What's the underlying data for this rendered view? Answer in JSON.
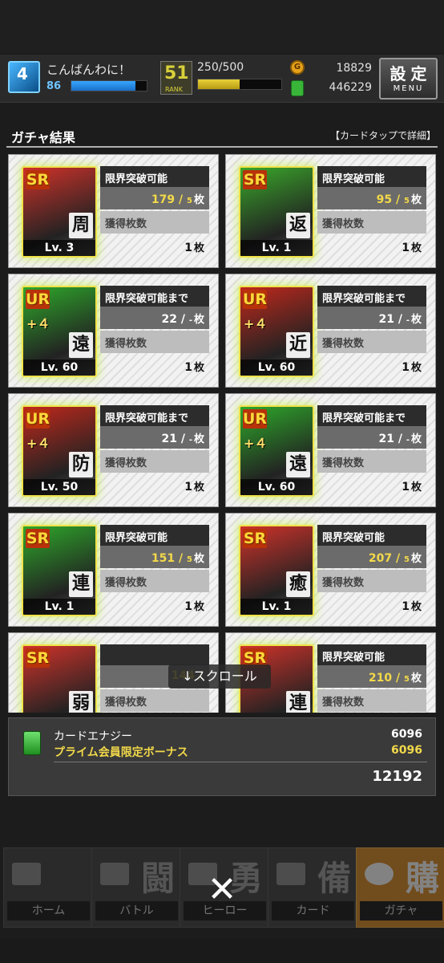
{
  "header": {
    "player_level": "4",
    "greeting": "こんばんわに！",
    "stamina": "86",
    "stamina_fill": 0.85,
    "rank": "51",
    "rank_label": "RANK",
    "exp": "250/500",
    "exp_fill": 0.5,
    "coins": "18829",
    "energy": "446229",
    "menu_label": "設定",
    "menu_sub": "MENU"
  },
  "results": {
    "title": "ガチャ結果",
    "hint": "【カードタップで詳細】",
    "cards": [
      {
        "rarity": "SR",
        "plus": "",
        "type": "周",
        "level": "Lv. 3",
        "status": "限界突破可能",
        "progress_num": "179",
        "progress_den": "5",
        "unit": "枚",
        "got_label": "獲得枚数",
        "got": "1",
        "color": "#d0322a",
        "gold": true
      },
      {
        "rarity": "SR",
        "plus": "",
        "type": "返",
        "level": "Lv. 1",
        "status": "限界突破可能",
        "progress_num": "95",
        "progress_den": "5",
        "unit": "枚",
        "got_label": "獲得枚数",
        "got": "1",
        "color": "#3aa82a",
        "gold": true
      },
      {
        "rarity": "UR",
        "plus": "+４",
        "type": "遠",
        "level": "Lv. 60",
        "status": "限界突破可能まで",
        "progress_num": "22",
        "progress_den": "-",
        "unit": "枚",
        "got_label": "獲得枚数",
        "got": "1",
        "color": "#2ea82a",
        "gold": false
      },
      {
        "rarity": "UR",
        "plus": "+４",
        "type": "近",
        "level": "Lv. 60",
        "status": "限界突破可能まで",
        "progress_num": "21",
        "progress_den": "-",
        "unit": "枚",
        "got_label": "獲得枚数",
        "got": "1",
        "color": "#c0281c",
        "gold": false
      },
      {
        "rarity": "UR",
        "plus": "+４",
        "type": "防",
        "level": "Lv. 50",
        "status": "限界突破可能まで",
        "progress_num": "21",
        "progress_den": "-",
        "unit": "枚",
        "got_label": "獲得枚数",
        "got": "1",
        "color": "#c0281c",
        "gold": false
      },
      {
        "rarity": "UR",
        "plus": "+４",
        "type": "遠",
        "level": "Lv. 60",
        "status": "限界突破可能まで",
        "progress_num": "21",
        "progress_den": "-",
        "unit": "枚",
        "got_label": "獲得枚数",
        "got": "1",
        "color": "#2ea82a",
        "gold": false
      },
      {
        "rarity": "SR",
        "plus": "",
        "type": "連",
        "level": "Lv. 1",
        "status": "限界突破可能",
        "progress_num": "151",
        "progress_den": "5",
        "unit": "枚",
        "got_label": "獲得枚数",
        "got": "1",
        "color": "#2ea82a",
        "gold": true
      },
      {
        "rarity": "SR",
        "plus": "",
        "type": "癒",
        "level": "Lv. 1",
        "status": "限界突破可能",
        "progress_num": "207",
        "progress_den": "5",
        "unit": "枚",
        "got_label": "獲得枚数",
        "got": "1",
        "color": "#d0322a",
        "gold": true
      },
      {
        "rarity": "SR",
        "plus": "",
        "type": "弱",
        "level": "",
        "status": "",
        "progress_num": "144",
        "progress_den": "",
        "unit": "",
        "got_label": "獲得枚数",
        "got": "",
        "color": "#d0322a",
        "gold": true
      },
      {
        "rarity": "SR",
        "plus": "",
        "type": "連",
        "level": "",
        "status": "限界突破可能",
        "progress_num": "210",
        "progress_den": "5",
        "unit": "枚",
        "got_label": "獲得枚数",
        "got": "",
        "color": "#d0322a",
        "gold": true
      }
    ],
    "scroll_tip": "↓スクロール"
  },
  "summary": {
    "label1": "カードエナジー",
    "label2": "プライム会員限定ボーナス",
    "value1": "6096",
    "value2": "6096",
    "total": "12192"
  },
  "nav": [
    {
      "label": "ホーム",
      "glyph": "",
      "active": false
    },
    {
      "label": "バトル",
      "glyph": "闘",
      "active": false
    },
    {
      "label": "ヒーロー",
      "glyph": "勇",
      "active": false
    },
    {
      "label": "カード",
      "glyph": "備",
      "active": false
    },
    {
      "label": "ガチャ",
      "glyph": "購",
      "active": true
    }
  ],
  "close_label": "✕"
}
